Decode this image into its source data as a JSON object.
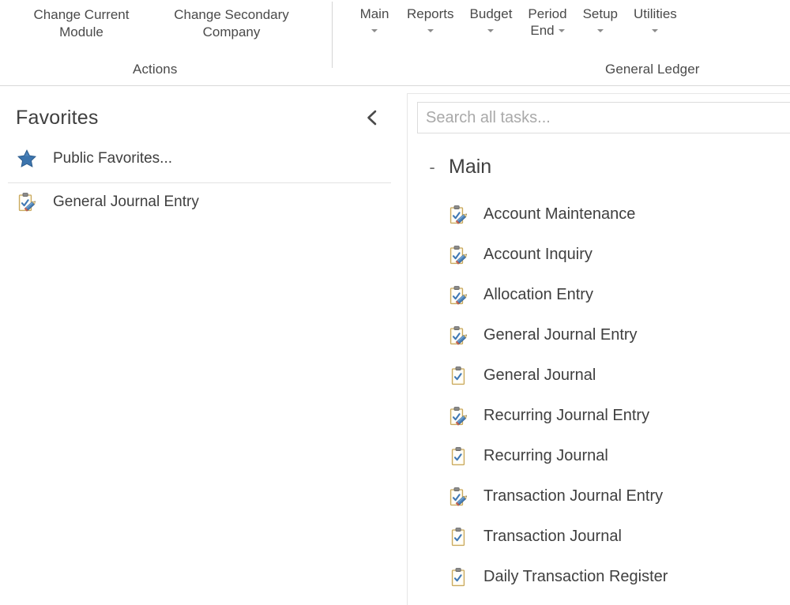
{
  "ribbon": {
    "groups": [
      {
        "name": "Actions",
        "label": "Actions",
        "buttons": [
          {
            "type": "action",
            "label_line1": "Change Current",
            "label_line2": "Module",
            "icon": "change-module-icon"
          },
          {
            "type": "action",
            "label_line1": "Change Secondary",
            "label_line2": "Company",
            "icon": "change-company-icon"
          }
        ]
      },
      {
        "name": "General Ledger",
        "label": "General Ledger",
        "buttons": [
          {
            "type": "menu",
            "label": "Main",
            "caret": "below",
            "icon": "chevron-down-icon"
          },
          {
            "type": "menu",
            "label": "Reports",
            "caret": "below",
            "icon": "chevron-down-icon"
          },
          {
            "type": "menu",
            "label": "Budget",
            "caret": "below",
            "icon": "chevron-down-icon"
          },
          {
            "type": "menu",
            "label_line1": "Period",
            "label_line2": "End",
            "caret": "inline",
            "icon": "chevron-down-icon"
          },
          {
            "type": "menu",
            "label": "Setup",
            "caret": "below",
            "icon": "chevron-down-icon"
          },
          {
            "type": "menu",
            "label": "Utilities",
            "caret": "below",
            "icon": "chevron-down-icon"
          }
        ]
      }
    ]
  },
  "favorites": {
    "title": "Favorites",
    "collapse_icon": "chevron-left-icon",
    "public_favorites": {
      "label": "Public Favorites...",
      "icon": "star-icon"
    },
    "items": [
      {
        "label": "General Journal Entry",
        "icon": "clipboard-pencil-icon"
      }
    ]
  },
  "tasks": {
    "search": {
      "placeholder": "Search all tasks...",
      "value": ""
    },
    "group": {
      "toggle": "-",
      "name": "Main",
      "expanded": true
    },
    "items": [
      {
        "label": "Account Maintenance",
        "icon": "clipboard-pencil-icon"
      },
      {
        "label": "Account Inquiry",
        "icon": "clipboard-pencil-icon"
      },
      {
        "label": "Allocation Entry",
        "icon": "clipboard-pencil-icon"
      },
      {
        "label": "General Journal Entry",
        "icon": "clipboard-pencil-icon"
      },
      {
        "label": "General Journal",
        "icon": "clipboard-icon"
      },
      {
        "label": "Recurring Journal Entry",
        "icon": "clipboard-pencil-icon"
      },
      {
        "label": "Recurring Journal",
        "icon": "clipboard-icon"
      },
      {
        "label": "Transaction Journal Entry",
        "icon": "clipboard-pencil-icon"
      },
      {
        "label": "Transaction Journal",
        "icon": "clipboard-icon"
      },
      {
        "label": "Daily Transaction Register",
        "icon": "clipboard-icon"
      }
    ]
  },
  "colors": {
    "background": "#ffffff",
    "text": "#3f3f3f",
    "muted_text": "#4a4a4a",
    "placeholder": "#a9a9a9",
    "border": "#d9d9d9",
    "divider": "#e2e2e2",
    "star_blue": "#3c74ad",
    "clipboard_tan": "#e8d9a8",
    "check_blue": "#3f78b4",
    "pencil_blue": "#4a7fb5"
  }
}
